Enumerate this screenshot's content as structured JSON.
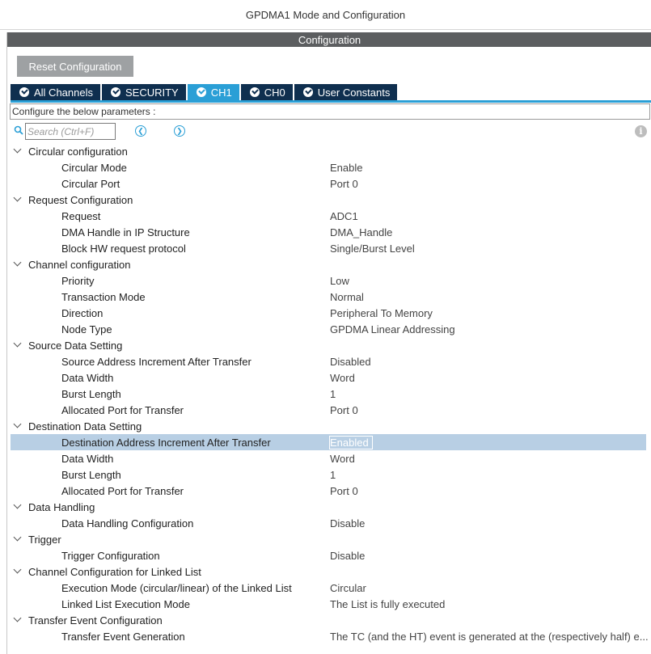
{
  "window": {
    "title": "GPDMA1 Mode and Configuration"
  },
  "config_header": "Configuration",
  "reset_button": "Reset Configuration",
  "tabs": [
    {
      "label": "All Channels",
      "active": false
    },
    {
      "label": "SECURITY",
      "active": false
    },
    {
      "label": "CH1",
      "active": true
    },
    {
      "label": "CH0",
      "active": false
    },
    {
      "label": "User Constants",
      "active": false
    }
  ],
  "params_label": "Configure the below parameters :",
  "search": {
    "placeholder": "Search (Ctrl+F)"
  },
  "groups": [
    {
      "label": "Circular configuration",
      "params": [
        {
          "name": "Circular Mode",
          "value": "Enable"
        },
        {
          "name": "Circular Port",
          "value": "Port 0"
        }
      ]
    },
    {
      "label": "Request Configuration",
      "params": [
        {
          "name": "Request",
          "value": "ADC1"
        },
        {
          "name": "DMA Handle in IP Structure",
          "value": "DMA_Handle"
        },
        {
          "name": "Block HW request protocol",
          "value": "Single/Burst Level"
        }
      ]
    },
    {
      "label": "Channel configuration",
      "params": [
        {
          "name": "Priority",
          "value": "Low"
        },
        {
          "name": "Transaction Mode",
          "value": "Normal"
        },
        {
          "name": "Direction",
          "value": "Peripheral To Memory"
        },
        {
          "name": "Node Type",
          "value": "GPDMA Linear Addressing"
        }
      ]
    },
    {
      "label": "Source Data Setting",
      "params": [
        {
          "name": "Source Address Increment After Transfer",
          "value": "Disabled"
        },
        {
          "name": "Data Width",
          "value": "Word"
        },
        {
          "name": "Burst Length",
          "value": "1"
        },
        {
          "name": "Allocated Port for Transfer",
          "value": "Port 0"
        }
      ]
    },
    {
      "label": "Destination Data Setting",
      "params": [
        {
          "name": "Destination Address Increment After Transfer",
          "value": "Enabled",
          "selected": true
        },
        {
          "name": "Data Width",
          "value": "Word"
        },
        {
          "name": "Burst Length",
          "value": "1"
        },
        {
          "name": "Allocated Port for Transfer",
          "value": "Port 0"
        }
      ]
    },
    {
      "label": "Data Handling",
      "params": [
        {
          "name": "Data Handling Configuration",
          "value": "Disable"
        }
      ]
    },
    {
      "label": "Trigger",
      "params": [
        {
          "name": "Trigger Configuration",
          "value": "Disable"
        }
      ]
    },
    {
      "label": "Channel Configuration for Linked List",
      "params": [
        {
          "name": "Execution Mode (circular/linear) of the Linked List",
          "value": "Circular"
        },
        {
          "name": "Linked List Execution Mode",
          "value": "The List is fully executed"
        }
      ]
    },
    {
      "label": "Transfer Event Configuration",
      "params": [
        {
          "name": "Transfer Event Generation",
          "value": "The TC (and the HT) event is generated at the (respectively half) e..."
        }
      ]
    }
  ],
  "colors": {
    "tab_bg": "#0f2f4f",
    "tab_active": "#2a9fd6",
    "header_bg": "#5c5e60",
    "selection": "#b8cfe4"
  }
}
